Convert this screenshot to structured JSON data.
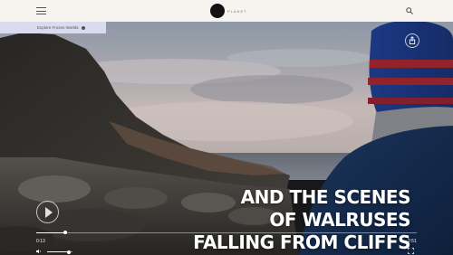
{
  "header": {
    "logo_text": "PLANET",
    "menu_icon": "hamburger-icon",
    "search_icon": "search-icon"
  },
  "chip": {
    "label": "Explore Frozen Worlds"
  },
  "caption": {
    "line1": "AND THE SCENES",
    "line2": "OF WALRUSES",
    "line3": "FALLING FROM CLIFFS"
  },
  "player": {
    "current_time": "0:13",
    "duration": "2:51",
    "progress_fraction": 0.076,
    "volume_fraction": 0.85,
    "play_icon": "play-icon",
    "share_icon": "share-icon",
    "volume_icon": "volume-icon",
    "fullscreen_icon": "fullscreen-icon"
  },
  "colors": {
    "header_bg": "#f7f4ef",
    "chip_bg": "#d9dbee",
    "caption_text": "#ffffff"
  }
}
